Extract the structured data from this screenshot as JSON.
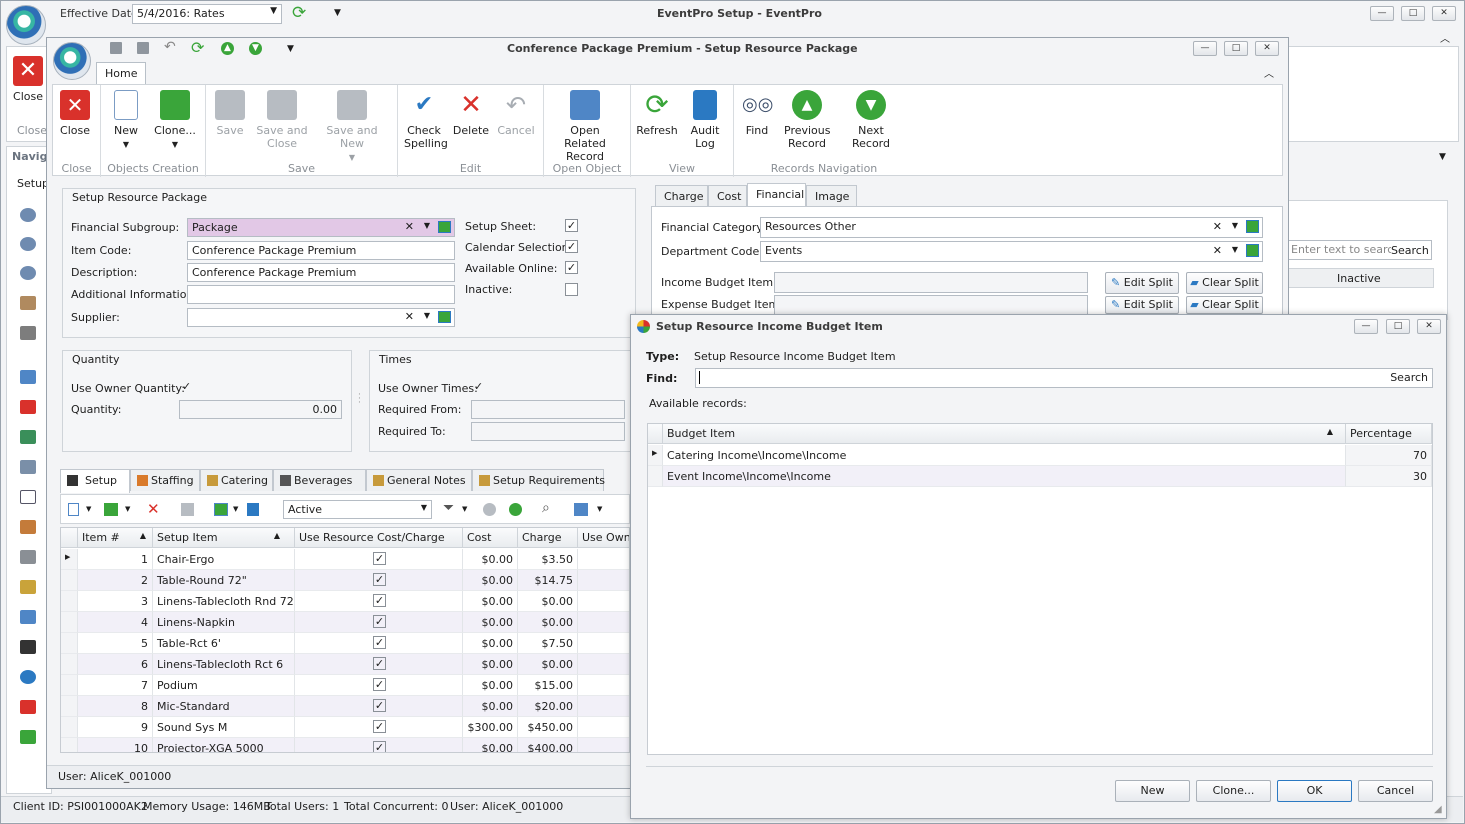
{
  "main": {
    "title": "EventPro Setup - EventPro",
    "effective_date_label": "Effective Date",
    "effective_date_value": "5/4/2016: Rates",
    "close_label": "Close",
    "close_group": "Close",
    "nav_header": "Navigation",
    "setup_label": "Setup"
  },
  "status": {
    "client_id": "Client ID: PSI001000AK2",
    "memory": "Memory Usage: 146MB",
    "total_users": "Total Users: 1",
    "total_concurrent": "Total Concurrent: 0",
    "user": "User: AliceK_001000"
  },
  "child": {
    "title": "Conference Package Premium - Setup Resource Package",
    "home_tab": "Home",
    "user_status": "User: AliceK_001000"
  },
  "ribbon": {
    "close": "Close",
    "new": "New",
    "clone": "Clone...",
    "save": "Save",
    "save_close": "Save and Close",
    "save_new": "Save and New",
    "check_spelling": "Check Spelling",
    "delete": "Delete",
    "cancel": "Cancel",
    "open_related": "Open Related Record",
    "refresh": "Refresh",
    "audit_log": "Audit Log",
    "find": "Find",
    "previous": "Previous Record",
    "next": "Next Record",
    "groups": {
      "close": "Close",
      "objects": "Objects Creation",
      "save": "Save",
      "edit": "Edit",
      "open": "Open Object",
      "view": "View",
      "nav": "Records Navigation"
    }
  },
  "form": {
    "section": "Setup Resource Package",
    "financial_subgroup_label": "Financial Subgroup:",
    "financial_subgroup_value": "Package",
    "item_code_label": "Item Code:",
    "item_code_value": "Conference Package Premium",
    "description_label": "Description:",
    "description_value": "Conference Package Premium",
    "additional_info_label": "Additional Information:",
    "supplier_label": "Supplier:",
    "setup_sheet_label": "Setup Sheet:",
    "calendar_selection_label": "Calendar Selection:",
    "available_online_label": "Available Online:",
    "inactive_label": "Inactive:"
  },
  "quantity": {
    "header": "Quantity",
    "use_owner_label": "Use Owner Quantity:",
    "quantity_label": "Quantity:",
    "quantity_value": "0.00"
  },
  "times": {
    "header": "Times",
    "use_owner_label": "Use Owner Times:",
    "required_from_label": "Required From:",
    "required_to_label": "Required To:"
  },
  "setup_tabs": [
    "Setup",
    "Staffing",
    "Catering",
    "Beverages",
    "General Notes",
    "Setup Requirements"
  ],
  "setup_toolbar": {
    "filter_value": "Active"
  },
  "setup_grid": {
    "columns": [
      "Item #",
      "Setup Item",
      "Use Resource Cost/Charge",
      "Cost",
      "Charge",
      "Use Owner"
    ],
    "rows": [
      {
        "num": "1",
        "item": "Chair-Ergo",
        "cost": "$0.00",
        "charge": "$3.50"
      },
      {
        "num": "2",
        "item": "Table-Round 72\"",
        "cost": "$0.00",
        "charge": "$14.75"
      },
      {
        "num": "3",
        "item": "Linens-Tablecloth Rnd 72",
        "cost": "$0.00",
        "charge": "$0.00"
      },
      {
        "num": "4",
        "item": "Linens-Napkin",
        "cost": "$0.00",
        "charge": "$0.00"
      },
      {
        "num": "5",
        "item": "Table-Rct 6'",
        "cost": "$0.00",
        "charge": "$7.50"
      },
      {
        "num": "6",
        "item": "Linens-Tablecloth Rct 6",
        "cost": "$0.00",
        "charge": "$0.00"
      },
      {
        "num": "7",
        "item": "Podium",
        "cost": "$0.00",
        "charge": "$15.00"
      },
      {
        "num": "8",
        "item": "Mic-Standard",
        "cost": "$0.00",
        "charge": "$20.00"
      },
      {
        "num": "9",
        "item": "Sound Sys M",
        "cost": "$300.00",
        "charge": "$450.00"
      },
      {
        "num": "10",
        "item": "Projector-XGA 5000",
        "cost": "$0.00",
        "charge": "$400.00"
      }
    ]
  },
  "right_tabs": [
    "Charge",
    "Cost",
    "Financial",
    "Image"
  ],
  "financial": {
    "category_label": "Financial Category:",
    "category_value": "Resources Other",
    "department_label": "Department Code:",
    "department_value": "Events",
    "income_label": "Income Budget Item:",
    "expense_label": "Expense Budget Item:",
    "edit_split": "Edit Split",
    "clear_split": "Clear Split"
  },
  "bg_grid": {
    "search_placeholder": "Enter text to search...",
    "search_btn": "Search",
    "inactive_col": "Inactive"
  },
  "dialog": {
    "title": "Setup Resource Income Budget Item",
    "type_label": "Type:",
    "type_value": "Setup Resource Income Budget Item",
    "find_label": "Find:",
    "search_btn": "Search",
    "available": "Available records:",
    "columns": [
      "Budget Item",
      "Percentage"
    ],
    "rows": [
      {
        "item": "Catering Income\\Income\\Income",
        "pct": "70"
      },
      {
        "item": "Event Income\\Income\\Income",
        "pct": "30"
      }
    ],
    "buttons": {
      "new": "New",
      "clone": "Clone...",
      "ok": "OK",
      "cancel": "Cancel"
    }
  },
  "colors": {
    "accent": "#2b79c2",
    "subgroup_bg": "#e2c8e6",
    "close_red": "#d9312b",
    "green": "#3aa53a"
  }
}
